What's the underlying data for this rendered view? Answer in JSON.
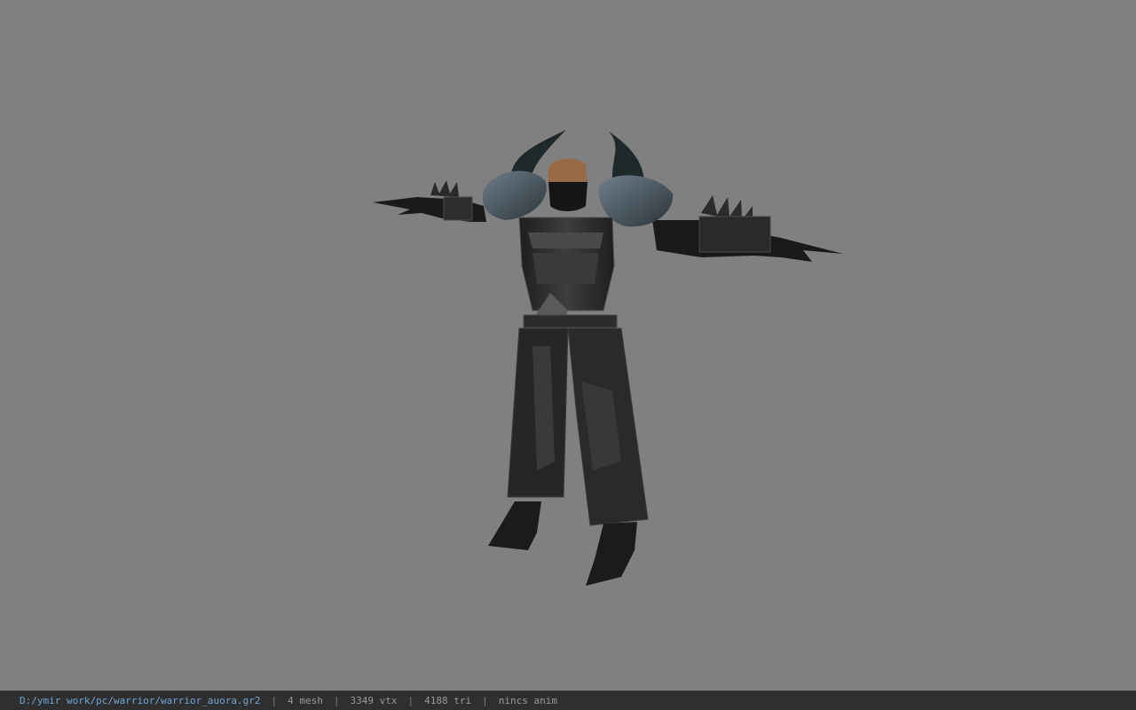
{
  "status_bar": {
    "path": "D:/ymir work/pc/warrior/warrior_auora.gr2",
    "mesh": "4 mesh",
    "vtx": "3349 vtx",
    "tri": "4188 tri",
    "anim": "nincs anim",
    "separator": "|"
  },
  "colors": {
    "background": "#808080",
    "status_bar_bg": "#2f2f2f",
    "path_text": "#6fa6d6",
    "status_text": "#9a9a9a"
  },
  "viewport": {
    "model": "warrior-armor-model"
  }
}
